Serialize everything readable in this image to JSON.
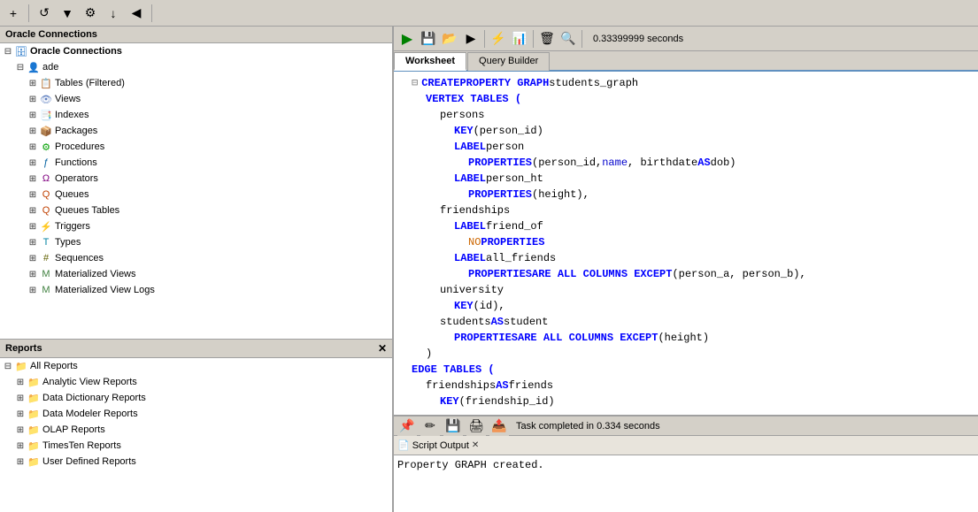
{
  "toolbar": {
    "buttons": [
      "+",
      "↺",
      "▼",
      "⚙",
      "↓",
      "◀"
    ],
    "timer_label": "0.33399999 seconds"
  },
  "left_panel": {
    "connections_header": "Oracle Connections",
    "tree": [
      {
        "id": "root",
        "indent": 0,
        "expand": "⊟",
        "icon": "🗄",
        "icon_class": "icon-conn",
        "label": "Oracle Connections",
        "bold": true
      },
      {
        "id": "ade",
        "indent": 1,
        "expand": "⊟",
        "icon": "👤",
        "icon_class": "icon-conn",
        "label": "ade"
      },
      {
        "id": "tables",
        "indent": 2,
        "expand": "⊞",
        "icon": "📋",
        "icon_class": "icon-table",
        "label": "Tables (Filtered)"
      },
      {
        "id": "views",
        "indent": 2,
        "expand": "⊞",
        "icon": "👁",
        "icon_class": "icon-view",
        "label": "Views"
      },
      {
        "id": "indexes",
        "indent": 2,
        "expand": "⊞",
        "icon": "📑",
        "icon_class": "icon-index",
        "label": "Indexes"
      },
      {
        "id": "packages",
        "indent": 2,
        "expand": "⊞",
        "icon": "📦",
        "icon_class": "icon-pkg",
        "label": "Packages"
      },
      {
        "id": "procedures",
        "indent": 2,
        "expand": "⊞",
        "icon": "⚙",
        "icon_class": "icon-proc",
        "label": "Procedures"
      },
      {
        "id": "functions",
        "indent": 2,
        "expand": "⊞",
        "icon": "ƒ",
        "icon_class": "icon-func",
        "label": "Functions"
      },
      {
        "id": "operators",
        "indent": 2,
        "expand": "⊞",
        "icon": "Ω",
        "icon_class": "icon-oper",
        "label": "Operators"
      },
      {
        "id": "queues",
        "indent": 2,
        "expand": "⊞",
        "icon": "Q",
        "icon_class": "icon-queue",
        "label": "Queues"
      },
      {
        "id": "queues_tables",
        "indent": 2,
        "expand": "⊞",
        "icon": "Q",
        "icon_class": "icon-queue",
        "label": "Queues Tables"
      },
      {
        "id": "triggers",
        "indent": 2,
        "expand": "⊞",
        "icon": "⚡",
        "icon_class": "icon-trig",
        "label": "Triggers"
      },
      {
        "id": "types",
        "indent": 2,
        "expand": "⊞",
        "icon": "T",
        "icon_class": "icon-type",
        "label": "Types"
      },
      {
        "id": "sequences",
        "indent": 2,
        "expand": "⊞",
        "icon": "#",
        "icon_class": "icon-seq",
        "label": "Sequences"
      },
      {
        "id": "mat_views",
        "indent": 2,
        "expand": "⊞",
        "icon": "M",
        "icon_class": "icon-matv",
        "label": "Materialized Views"
      },
      {
        "id": "mat_view_logs",
        "indent": 2,
        "expand": "⊞",
        "icon": "M",
        "icon_class": "icon-matv",
        "label": "Materialized View Logs"
      }
    ]
  },
  "reports_panel": {
    "header": "Reports",
    "items": [
      {
        "id": "all_reports",
        "indent": 0,
        "expand": "⊟",
        "icon": "📁",
        "label": "All Reports"
      },
      {
        "id": "analytic_view",
        "indent": 1,
        "expand": "⊞",
        "icon": "📁",
        "label": "Analytic View Reports"
      },
      {
        "id": "data_dict",
        "indent": 1,
        "expand": "⊞",
        "icon": "📁",
        "label": "Data Dictionary Reports"
      },
      {
        "id": "data_modeler",
        "indent": 1,
        "expand": "⊞",
        "icon": "📁",
        "label": "Data Modeler Reports"
      },
      {
        "id": "olap",
        "indent": 1,
        "expand": "⊞",
        "icon": "📁",
        "label": "OLAP Reports"
      },
      {
        "id": "timesten",
        "indent": 1,
        "expand": "⊞",
        "icon": "📁",
        "label": "TimesTen Reports"
      },
      {
        "id": "user_def",
        "indent": 1,
        "expand": "⊞",
        "icon": "📁",
        "label": "User Defined Reports"
      }
    ]
  },
  "right_panel": {
    "toolbar_timer": "0.33399999 seconds",
    "tabs": [
      {
        "id": "worksheet",
        "label": "Worksheet",
        "active": true
      },
      {
        "id": "query_builder",
        "label": "Query Builder",
        "active": false
      }
    ],
    "code_lines": [
      {
        "indent": 2,
        "has_collapse": true,
        "parts": [
          {
            "text": "CREATE ",
            "cls": "kw-blue"
          },
          {
            "text": "PROPERTY GRAPH ",
            "cls": "kw-blue"
          },
          {
            "text": "students_graph",
            "cls": "txt-black"
          }
        ]
      },
      {
        "indent": 4,
        "parts": [
          {
            "text": "VERTEX TABLES (",
            "cls": "kw-blue"
          }
        ]
      },
      {
        "indent": 6,
        "parts": [
          {
            "text": "persons",
            "cls": "txt-black"
          }
        ]
      },
      {
        "indent": 8,
        "parts": [
          {
            "text": "KEY ",
            "cls": "kw-blue"
          },
          {
            "text": "(person_id)",
            "cls": "txt-black"
          }
        ]
      },
      {
        "indent": 8,
        "parts": [
          {
            "text": "LABEL ",
            "cls": "kw-blue"
          },
          {
            "text": "person",
            "cls": "txt-black"
          }
        ]
      },
      {
        "indent": 10,
        "parts": [
          {
            "text": "PROPERTIES ",
            "cls": "kw-blue"
          },
          {
            "text": "(person_id, ",
            "cls": "txt-black"
          },
          {
            "text": "name",
            "cls": "txt-link"
          },
          {
            "text": ", birthdate ",
            "cls": "txt-black"
          },
          {
            "text": "AS ",
            "cls": "kw-blue"
          },
          {
            "text": "dob)",
            "cls": "txt-black"
          }
        ]
      },
      {
        "indent": 8,
        "parts": [
          {
            "text": "LABEL ",
            "cls": "kw-blue"
          },
          {
            "text": "person_ht",
            "cls": "txt-black"
          }
        ]
      },
      {
        "indent": 10,
        "parts": [
          {
            "text": "PROPERTIES ",
            "cls": "kw-blue"
          },
          {
            "text": "(height),",
            "cls": "txt-black"
          }
        ]
      },
      {
        "indent": 6,
        "parts": [
          {
            "text": "friendships",
            "cls": "txt-black"
          }
        ]
      },
      {
        "indent": 8,
        "parts": [
          {
            "text": "LABEL ",
            "cls": "kw-blue"
          },
          {
            "text": "friend_of",
            "cls": "txt-black"
          }
        ]
      },
      {
        "indent": 10,
        "parts": [
          {
            "text": "NO ",
            "cls": "kw-orange"
          },
          {
            "text": "PROPERTIES",
            "cls": "kw-blue"
          }
        ]
      },
      {
        "indent": 8,
        "parts": [
          {
            "text": "LABEL ",
            "cls": "kw-blue"
          },
          {
            "text": "all_friends",
            "cls": "txt-black"
          }
        ]
      },
      {
        "indent": 10,
        "parts": [
          {
            "text": "PROPERTIES ",
            "cls": "kw-blue"
          },
          {
            "text": "ARE ALL COLUMNS EXCEPT ",
            "cls": "kw-blue"
          },
          {
            "text": "(person_a, person_b),",
            "cls": "txt-black"
          }
        ]
      },
      {
        "indent": 6,
        "parts": [
          {
            "text": "university",
            "cls": "txt-black"
          }
        ]
      },
      {
        "indent": 8,
        "parts": [
          {
            "text": "KEY ",
            "cls": "kw-blue"
          },
          {
            "text": "(id),",
            "cls": "txt-black"
          }
        ]
      },
      {
        "indent": 6,
        "parts": [
          {
            "text": "students ",
            "cls": "txt-black"
          },
          {
            "text": "AS ",
            "cls": "kw-blue"
          },
          {
            "text": "student",
            "cls": "txt-black"
          }
        ]
      },
      {
        "indent": 8,
        "parts": [
          {
            "text": "PROPERTIES ",
            "cls": "kw-blue"
          },
          {
            "text": "ARE ALL COLUMNS EXCEPT ",
            "cls": "kw-blue"
          },
          {
            "text": "(height)",
            "cls": "txt-black"
          }
        ]
      },
      {
        "indent": 4,
        "parts": [
          {
            "text": ")",
            "cls": "txt-black"
          }
        ]
      },
      {
        "indent": 2,
        "parts": [
          {
            "text": "EDGE TABLES (",
            "cls": "kw-blue"
          }
        ]
      },
      {
        "indent": 4,
        "parts": [
          {
            "text": "friendships ",
            "cls": "txt-black"
          },
          {
            "text": "AS ",
            "cls": "kw-blue"
          },
          {
            "text": "friends",
            "cls": "txt-black"
          }
        ]
      },
      {
        "indent": 6,
        "parts": [
          {
            "text": "KEY ",
            "cls": "kw-blue"
          },
          {
            "text": "(friendship_id)",
            "cls": "txt-black"
          }
        ]
      }
    ]
  },
  "bottom_panel": {
    "tab_label": "Script Output",
    "toolbar_status": "Task completed in 0.334 seconds",
    "output_text": "Property GRAPH created."
  }
}
